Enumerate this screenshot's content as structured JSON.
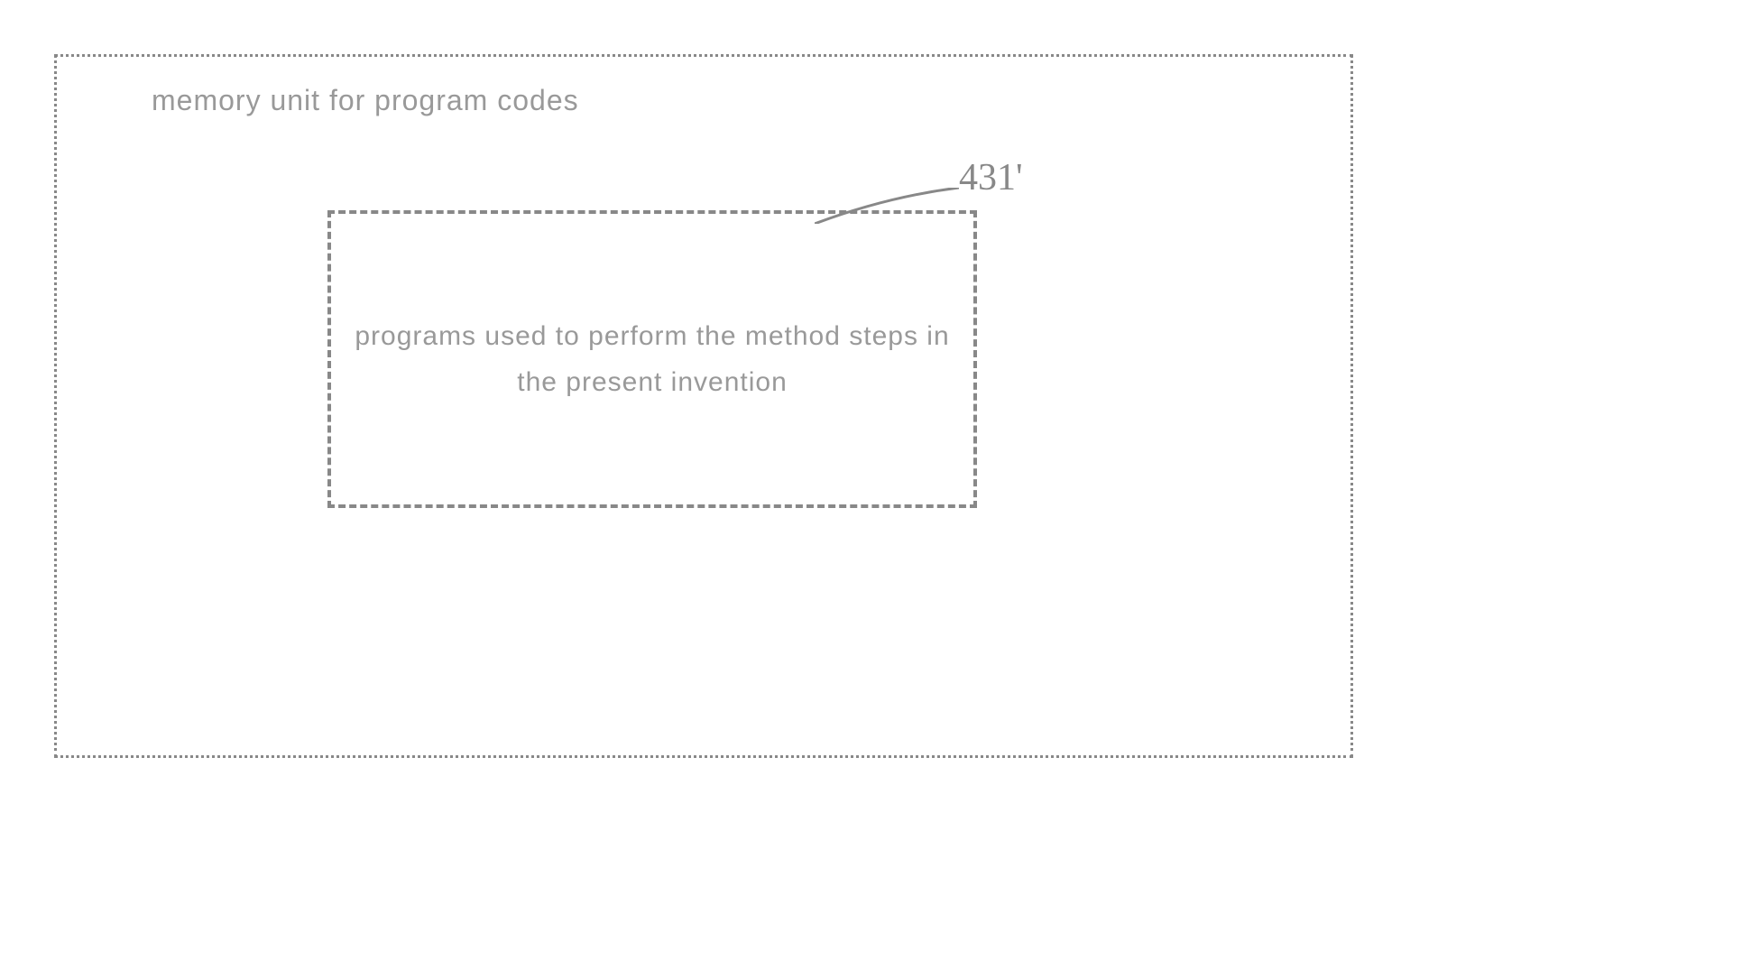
{
  "diagram": {
    "outer_label": "memory unit for program codes",
    "inner_text": "programs used to perform the method steps in the present invention",
    "reference_number": "431'"
  }
}
